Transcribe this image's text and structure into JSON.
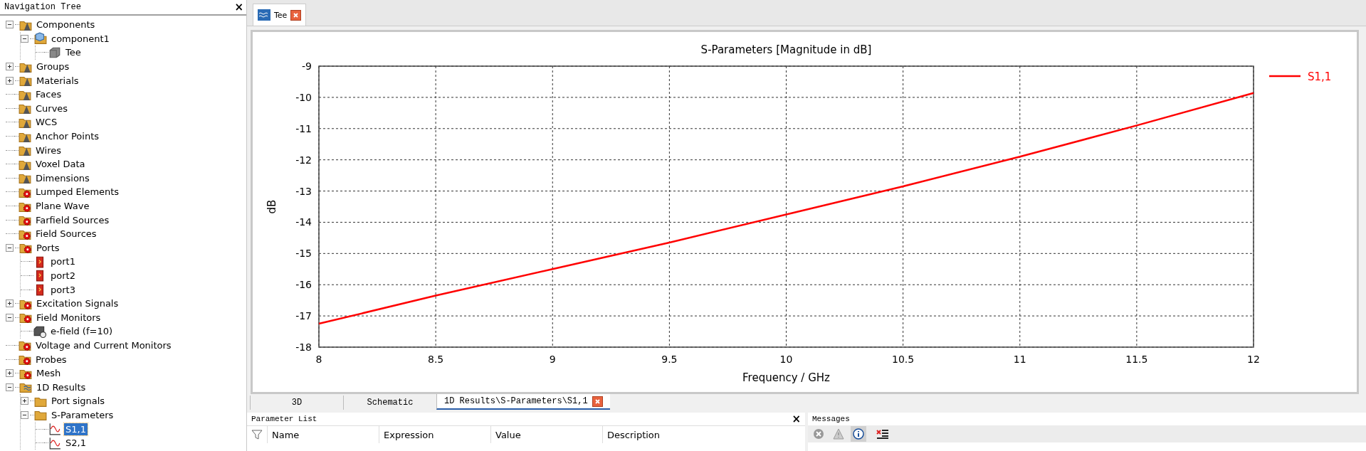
{
  "navigation_tree": {
    "title": "Navigation Tree",
    "close": "×",
    "items": [
      {
        "label": "Components",
        "kind": "geometry-folder",
        "expanded": true,
        "selected": false,
        "children": [
          {
            "label": "component1",
            "kind": "component",
            "expanded": true,
            "selected": false,
            "children": [
              {
                "label": "Tee",
                "kind": "solid",
                "selected": false
              }
            ]
          }
        ]
      },
      {
        "label": "Groups",
        "kind": "geometry-folder",
        "expanded": false,
        "selected": false
      },
      {
        "label": "Materials",
        "kind": "geometry-folder",
        "expanded": false,
        "selected": false
      },
      {
        "label": "Faces",
        "kind": "geometry-folder",
        "selected": false
      },
      {
        "label": "Curves",
        "kind": "geometry-folder",
        "selected": false
      },
      {
        "label": "WCS",
        "kind": "geometry-folder",
        "selected": false
      },
      {
        "label": "Anchor Points",
        "kind": "geometry-folder",
        "selected": false
      },
      {
        "label": "Wires",
        "kind": "geometry-folder",
        "selected": false
      },
      {
        "label": "Voxel Data",
        "kind": "geometry-folder",
        "selected": false
      },
      {
        "label": "Dimensions",
        "kind": "geometry-folder",
        "selected": false
      },
      {
        "label": "Lumped Elements",
        "kind": "source-folder",
        "selected": false
      },
      {
        "label": "Plane Wave",
        "kind": "source-folder",
        "selected": false
      },
      {
        "label": "Farfield Sources",
        "kind": "source-folder",
        "selected": false
      },
      {
        "label": "Field Sources",
        "kind": "source-folder",
        "selected": false
      },
      {
        "label": "Ports",
        "kind": "source-folder",
        "expanded": true,
        "selected": false,
        "children": [
          {
            "label": "port1",
            "kind": "port",
            "selected": false
          },
          {
            "label": "port2",
            "kind": "port",
            "selected": false
          },
          {
            "label": "port3",
            "kind": "port",
            "selected": false
          }
        ]
      },
      {
        "label": "Excitation Signals",
        "kind": "source-folder",
        "expanded": false,
        "selected": false
      },
      {
        "label": "Field Monitors",
        "kind": "source-folder",
        "expanded": true,
        "selected": false,
        "children": [
          {
            "label": "e-field (f=10)",
            "kind": "monitor",
            "selected": false
          }
        ]
      },
      {
        "label": "Voltage and Current Monitors",
        "kind": "source-folder",
        "selected": false
      },
      {
        "label": "Probes",
        "kind": "source-folder",
        "selected": false
      },
      {
        "label": "Mesh",
        "kind": "source-folder",
        "expanded": false,
        "selected": false
      },
      {
        "label": "1D Results",
        "kind": "results-folder",
        "expanded": true,
        "selected": false,
        "children": [
          {
            "label": "Port signals",
            "kind": "folder",
            "expanded": false,
            "selected": false
          },
          {
            "label": "S-Parameters",
            "kind": "folder",
            "expanded": true,
            "selected": false,
            "children": [
              {
                "label": "S1,1",
                "kind": "result",
                "selected": true
              },
              {
                "label": "S2,1",
                "kind": "result",
                "selected": false
              }
            ]
          }
        ]
      }
    ]
  },
  "document_tabs": [
    {
      "label": "Tee",
      "selected": true
    }
  ],
  "plot": {
    "chart_data": {
      "type": "line",
      "title": "S-Parameters [Magnitude in dB]",
      "xlabel": "Frequency / GHz",
      "ylabel": "dB",
      "x": [
        8,
        8.5,
        9,
        9.5,
        10,
        10.5,
        11,
        11.5,
        12
      ],
      "series": [
        {
          "name": "S1,1",
          "color": "#ff0000",
          "values": [
            -17.25,
            -16.35,
            -15.5,
            -14.65,
            -13.75,
            -12.85,
            -11.9,
            -10.9,
            -9.86
          ]
        }
      ],
      "xlim": [
        8,
        12
      ],
      "ylim": [
        -18,
        -9
      ],
      "xticks": [
        8,
        8.5,
        9,
        9.5,
        10,
        10.5,
        11,
        11.5,
        12
      ],
      "yticks": [
        -9,
        -10,
        -11,
        -12,
        -13,
        -14,
        -15,
        -16,
        -17,
        -18
      ],
      "grid": true
    }
  },
  "view_tabs": [
    {
      "label": "3D",
      "selected": false
    },
    {
      "label": "Schematic",
      "selected": false
    },
    {
      "label": "1D Results\\S-Parameters\\S1,1",
      "selected": true
    }
  ],
  "parameter_list": {
    "title": "Parameter List",
    "close": "×",
    "columns": [
      "Name",
      "Expression",
      "Value",
      "Description"
    ]
  },
  "messages": {
    "title": "Messages",
    "filters": [
      {
        "kind": "error",
        "selected": false
      },
      {
        "kind": "warning",
        "selected": false
      },
      {
        "kind": "info",
        "selected": true
      }
    ]
  }
}
